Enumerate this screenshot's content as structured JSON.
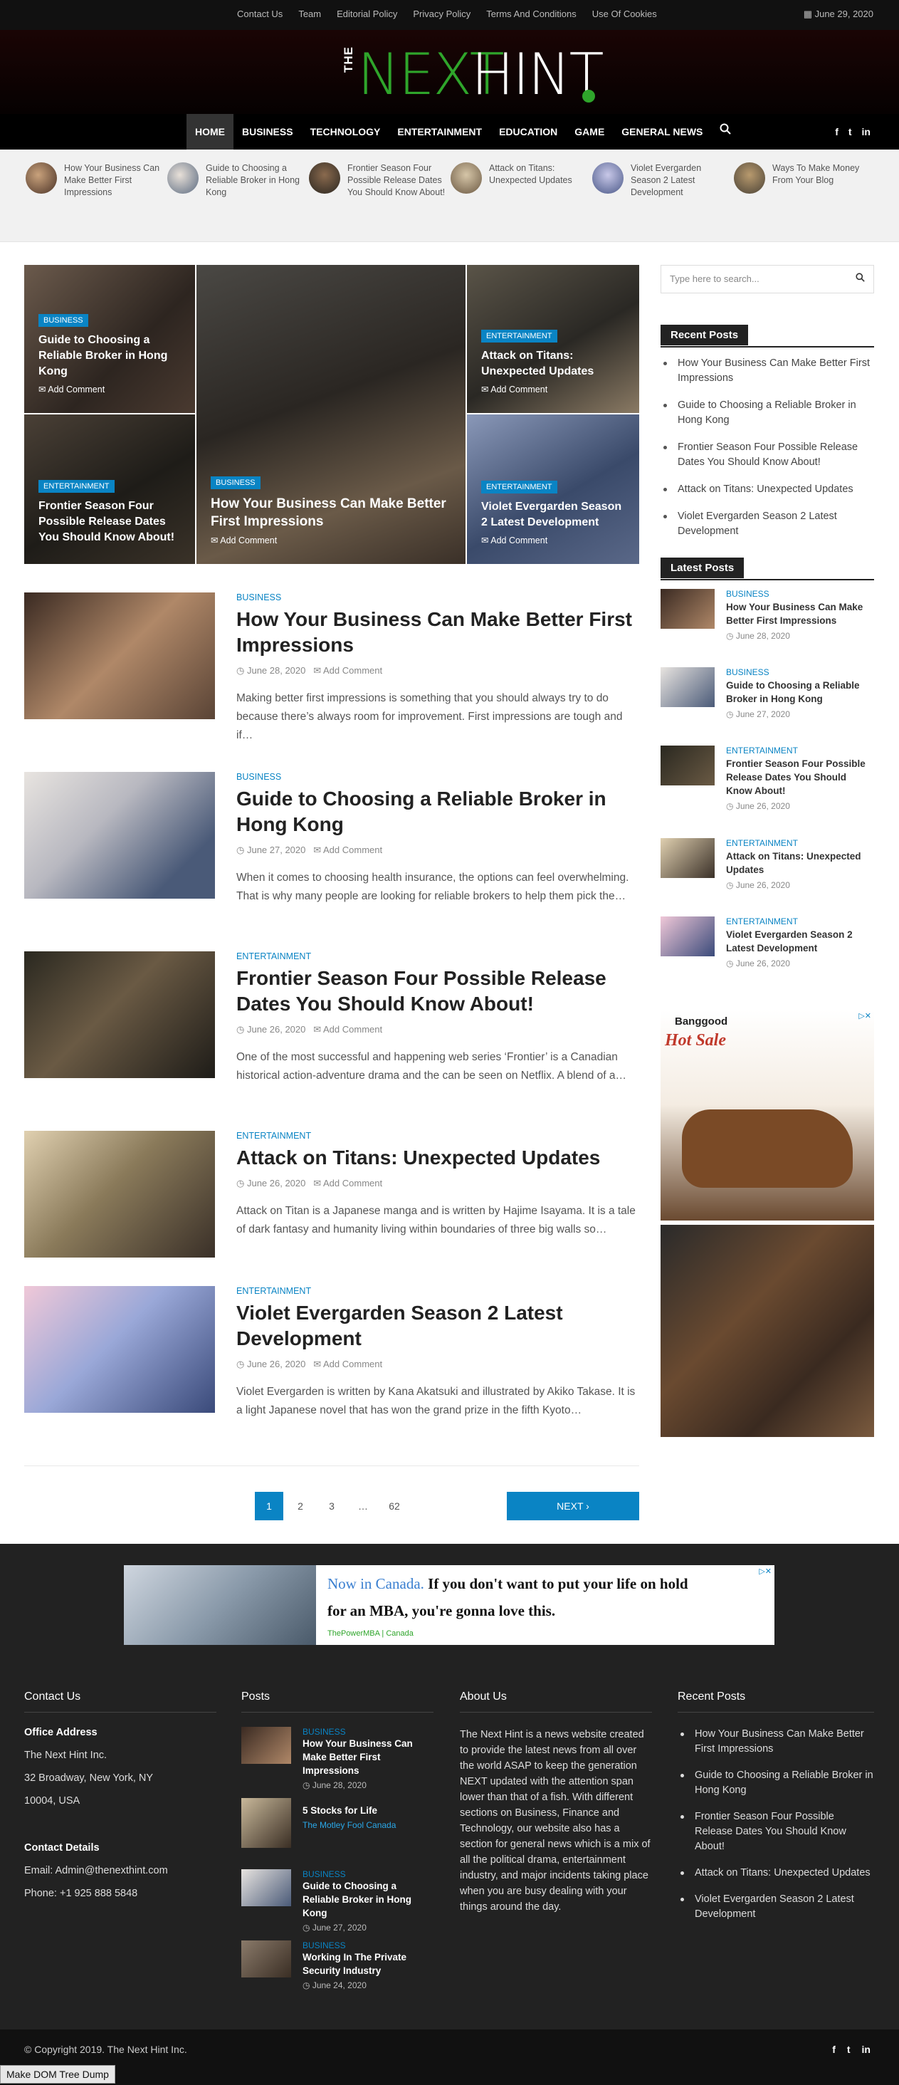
{
  "topbar": {
    "links": [
      "Contact Us",
      "Team",
      "Editorial Policy",
      "Privacy Policy",
      "Terms And Conditions",
      "Use Of Cookies"
    ],
    "date": "June 29, 2020"
  },
  "logo": {
    "the": "THE",
    "next": "NEXT",
    "hint": "HINT"
  },
  "nav": {
    "items": [
      "HOME",
      "BUSINESS",
      "TECHNOLOGY",
      "ENTERTAINMENT",
      "EDUCATION",
      "GAME",
      "GENERAL NEWS"
    ],
    "social": [
      "f",
      "t",
      "in"
    ]
  },
  "ticker": [
    "How Your Business Can Make Better First Impressions",
    "Guide to Choosing a Reliable Broker in Hong Kong",
    "Frontier Season Four Possible Release Dates You Should Know About!",
    "Attack on Titans: Unexpected Updates",
    "Violet Evergarden Season 2 Latest Development",
    "Ways To Make Money From Your Blog"
  ],
  "featured": [
    {
      "cat": "BUSINESS",
      "title": "Guide to Choosing a Reliable Broker in Hong Kong",
      "comment": "Add Comment"
    },
    {
      "cat": "BUSINESS",
      "title": "How Your Business Can Make Better First Impressions",
      "comment": "Add Comment"
    },
    {
      "cat": "ENTERTAINMENT",
      "title": "Attack on Titans: Unexpected Updates",
      "comment": "Add Comment"
    },
    {
      "cat": "ENTERTAINMENT",
      "title": "Frontier Season Four Possible Release Dates You Should Know About!",
      "comment": "Add Comment"
    },
    {
      "cat": "ENTERTAINMENT",
      "title": "Violet Evergarden Season 2 Latest Development",
      "comment": "Add Comment"
    }
  ],
  "articles": [
    {
      "cat": "BUSINESS",
      "title": "How Your Business Can Make Better First Impressions",
      "date": "June 28, 2020",
      "comment": "Add Comment",
      "excerpt": "Making better first impressions is something that you should always try to do because there’s always room for improvement. First impressions are tough and if…"
    },
    {
      "cat": "BUSINESS",
      "title": "Guide to Choosing a Reliable Broker in Hong Kong",
      "date": "June 27, 2020",
      "comment": "Add Comment",
      "excerpt": "When it comes to choosing health insurance, the options can feel overwhelming. That is why many people are looking for reliable brokers to help them pick the…"
    },
    {
      "cat": "ENTERTAINMENT",
      "title": "Frontier Season Four Possible Release Dates You Should Know About!",
      "date": "June 26, 2020",
      "comment": "Add Comment",
      "excerpt": "One of the most successful and happening web series ‘Frontier’ is a Canadian historical action-adventure drama and the can be seen on Netflix. A blend of a…"
    },
    {
      "cat": "ENTERTAINMENT",
      "title": "Attack on Titans: Unexpected Updates",
      "date": "June 26, 2020",
      "comment": "Add Comment",
      "excerpt": "Attack on Titan is a Japanese manga and is written by Hajime Isayama. It is a tale of dark fantasy and humanity living within boundaries of three big walls so…"
    },
    {
      "cat": "ENTERTAINMENT",
      "title": "Violet Evergarden Season 2 Latest Development",
      "date": "June 26, 2020",
      "comment": "Add Comment",
      "excerpt": "Violet Evergarden is written by Kana Akatsuki and illustrated by Akiko Takase. It is a light Japanese novel that has won the grand prize in the fifth Kyoto…"
    }
  ],
  "pager": {
    "pages": [
      "1",
      "2",
      "3",
      "…",
      "62"
    ],
    "next": "NEXT ›"
  },
  "sidebar": {
    "search_placeholder": "Type here to search...",
    "recent_title": "Recent Posts",
    "recent": [
      "How Your Business Can Make Better First Impressions",
      "Guide to Choosing a Reliable Broker in Hong Kong",
      "Frontier Season Four Possible Release Dates You Should Know About!",
      "Attack on Titans: Unexpected Updates",
      "Violet Evergarden Season 2 Latest Development"
    ],
    "latest_title": "Latest Posts",
    "latest": [
      {
        "cat": "BUSINESS",
        "title": "How Your Business Can Make Better First Impressions",
        "date": "June 28, 2020"
      },
      {
        "cat": "BUSINESS",
        "title": "Guide to Choosing a Reliable Broker in Hong Kong",
        "date": "June 27, 2020"
      },
      {
        "cat": "ENTERTAINMENT",
        "title": "Frontier Season Four Possible Release Dates You Should Know About!",
        "date": "June 26, 2020"
      },
      {
        "cat": "ENTERTAINMENT",
        "title": "Attack on Titans: Unexpected Updates",
        "date": "June 26, 2020"
      },
      {
        "cat": "ENTERTAINMENT",
        "title": "Violet Evergarden Season 2 Latest Development",
        "date": "June 26, 2020"
      }
    ],
    "ad_brand": "Banggood",
    "ad_text": "Hot Sale"
  },
  "footer_ad": {
    "line1a": "Now in Canada.",
    "line1b": "If you don't want to put your life on hold",
    "line2": "for an MBA, you're gonna love this.",
    "source": "ThePowerMBA | Canada"
  },
  "footer": {
    "contact_title": "Contact Us",
    "office_label": "Office Address",
    "office_lines": [
      "The Next Hint Inc.",
      "32 Broadway, New York, NY",
      "10004, USA"
    ],
    "details_label": "Contact Details",
    "email": "Email: Admin@thenexthint.com",
    "phone": "Phone: +1 925 888 5848",
    "posts_title": "Posts",
    "posts": [
      {
        "cat": "BUSINESS",
        "title": "How Your Business Can Make Better First Impressions",
        "date": "June 28, 2020"
      },
      {
        "cat": "",
        "title": "5 Stocks for Life",
        "date": "The Motley Fool Canada"
      },
      {
        "cat": "BUSINESS",
        "title": "Guide to Choosing a Reliable Broker in Hong Kong",
        "date": "June 27, 2020"
      },
      {
        "cat": "BUSINESS",
        "title": "Working In The Private Security Industry",
        "date": "June 24, 2020"
      }
    ],
    "about_title": "About Us",
    "about_text": "The Next Hint is a news website created to provide the latest news from all over the world ASAP to keep the generation NEXT updated with the attention span lower than that of a fish. With different sections on Business, Finance and Technology, our website also has a section for general news which is a mix of all the political drama, entertainment industry, and major incidents taking place when you are busy dealing with your things around the day.",
    "recent_title": "Recent Posts",
    "recent": [
      "How Your Business Can Make Better First Impressions",
      "Guide to Choosing a Reliable Broker in Hong Kong",
      "Frontier Season Four Possible Release Dates You Should Know About!",
      "Attack on Titans: Unexpected Updates",
      "Violet Evergarden Season 2 Latest Development"
    ],
    "copyright": "© Copyright 2019. The Next Hint Inc."
  },
  "domdump": "Make DOM Tree Dump"
}
